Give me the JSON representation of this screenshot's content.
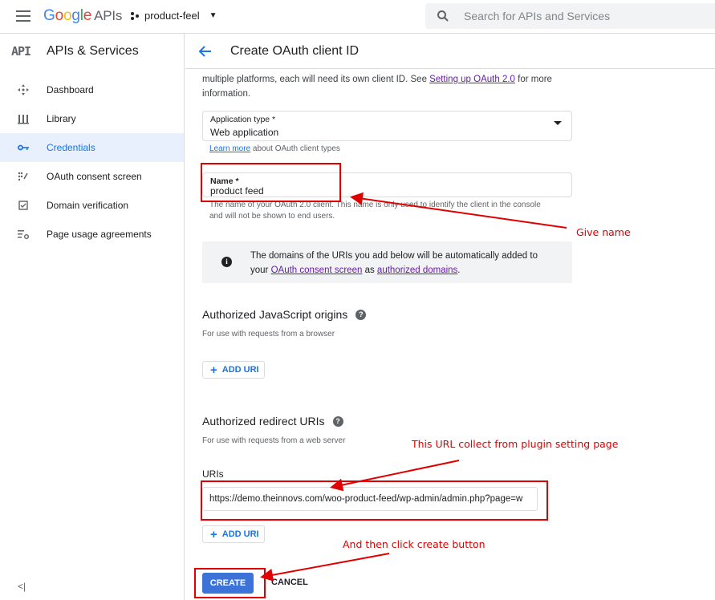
{
  "topbar": {
    "logo_google": "Google",
    "logo_apis": "APIs",
    "project_name": "product-feel",
    "search_placeholder": "Search for APIs and Services"
  },
  "sidebar": {
    "api_badge": "API",
    "title": "APIs & Services",
    "items": [
      {
        "label": "Dashboard",
        "icon": "dashboard-icon",
        "active": false
      },
      {
        "label": "Library",
        "icon": "library-icon",
        "active": false
      },
      {
        "label": "Credentials",
        "icon": "key-icon",
        "active": true
      },
      {
        "label": "OAuth consent screen",
        "icon": "consent-icon",
        "active": false
      },
      {
        "label": "Domain verification",
        "icon": "checkbox-icon",
        "active": false
      },
      {
        "label": "Page usage agreements",
        "icon": "settings-list-icon",
        "active": false
      }
    ],
    "collapse_label": "<|"
  },
  "main": {
    "page_title": "Create OAuth client ID",
    "intro_text_1": "multiple platforms, each will need its own client ID. See ",
    "intro_link": "Setting up OAuth 2.0",
    "intro_text_2": " for more information.",
    "app_type": {
      "label": "Application type *",
      "value": "Web application",
      "learn_more": "Learn more",
      "learn_more_suffix": " about OAuth client types"
    },
    "name_field": {
      "label": "Name *",
      "value": "product feed",
      "hint": "The name of your OAuth 2.0 client. This name is only used to identify the client in the console and will not be shown to end users."
    },
    "info": {
      "text_1": "The domains of the URIs you add below will be automatically added to your ",
      "link_1": "OAuth consent screen",
      "text_2": " as ",
      "link_2": "authorized domains",
      "text_3": "."
    },
    "js_origins": {
      "title": "Authorized JavaScript origins",
      "subtitle": "For use with requests from a browser",
      "add_label": "ADD URI"
    },
    "redirect_uris": {
      "title": "Authorized redirect URIs",
      "subtitle": "For use with requests from a web server",
      "uris_label": "URIs",
      "uri_value": "https://demo.theinnovs.com/woo-product-feed/wp-admin/admin.php?page=w",
      "add_label": "ADD URI"
    },
    "create_label": "CREATE",
    "cancel_label": "CANCEL"
  },
  "annotations": {
    "give_name": "Give name",
    "url_note": "This URL collect from plugin setting page",
    "create_note": "And then click create button",
    "color": "#e00000"
  }
}
